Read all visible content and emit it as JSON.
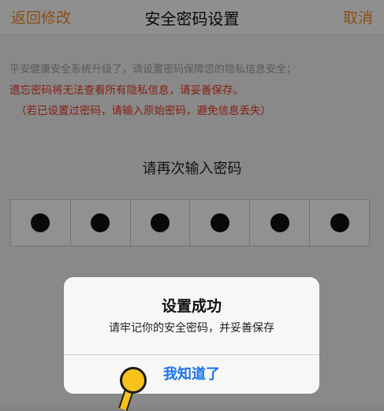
{
  "nav": {
    "back_label": "返回修改",
    "title": "安全密码设置",
    "cancel_label": "取消"
  },
  "notice": {
    "line1": "平安健康安全系统升级了，请设置密码保障您的隐私信息安全；",
    "line2": "遗忘密码将无法查看所有隐私信息，请妥善保存。",
    "line3": "（若已设置过密码，请输入原始密码，避免信息丢失）"
  },
  "prompt": "请再次输入密码",
  "pin": {
    "length": 6,
    "filled": 6
  },
  "dialog": {
    "title": "设置成功",
    "message": "请牢记你的安全密码，并妥善保存",
    "confirm_label": "我知道了"
  },
  "colors": {
    "accent": "#f08a24",
    "warning": "#e4361f",
    "link": "#1a73e8",
    "tap_marker": "#f8c21b"
  }
}
